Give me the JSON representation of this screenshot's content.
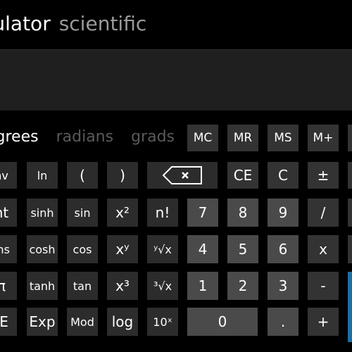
{
  "header": {
    "title": "culator",
    "mode": "scientific"
  },
  "display": {
    "value": ""
  },
  "angle_modes": [
    {
      "label": "egrees",
      "active": true
    },
    {
      "label": "radians",
      "active": false
    },
    {
      "label": "grads",
      "active": false
    }
  ],
  "memory": {
    "mc": "MC",
    "mr": "MR",
    "ms": "MS",
    "mplus": "M+"
  },
  "functions": {
    "inv": "nv",
    "ln": "ln",
    "lparen": "(",
    "rparen": ")",
    "int": "nt",
    "sinh": "sinh",
    "sin": "sin",
    "x2": "x²",
    "fact": "n!",
    "dms": "ms",
    "cosh": "cosh",
    "cos": "cos",
    "xy": "xʸ",
    "yroot": "ʸ√x",
    "pi": "π",
    "tanh": "tanh",
    "tan": "tan",
    "x3": "x³",
    "cuberoot": "³√x",
    "fe": "-E",
    "exp": "Exp",
    "mod": "Mod",
    "log": "log",
    "ten_x": "10ˣ"
  },
  "keypad": {
    "ce": "CE",
    "c": "C",
    "sign": "±",
    "seven": "7",
    "eight": "8",
    "nine": "9",
    "divide": "/",
    "four": "4",
    "five": "5",
    "six": "6",
    "multiply": "x",
    "one": "1",
    "two": "2",
    "three": "3",
    "minus": "-",
    "zero": "0",
    "dot": ".",
    "plus": "+"
  },
  "icons": {
    "backspace": "backspace-icon"
  },
  "colors": {
    "background": "#000000",
    "accent": "#1e6ea3",
    "digit": "#4a4a4a",
    "function": "#2c2c2c"
  }
}
